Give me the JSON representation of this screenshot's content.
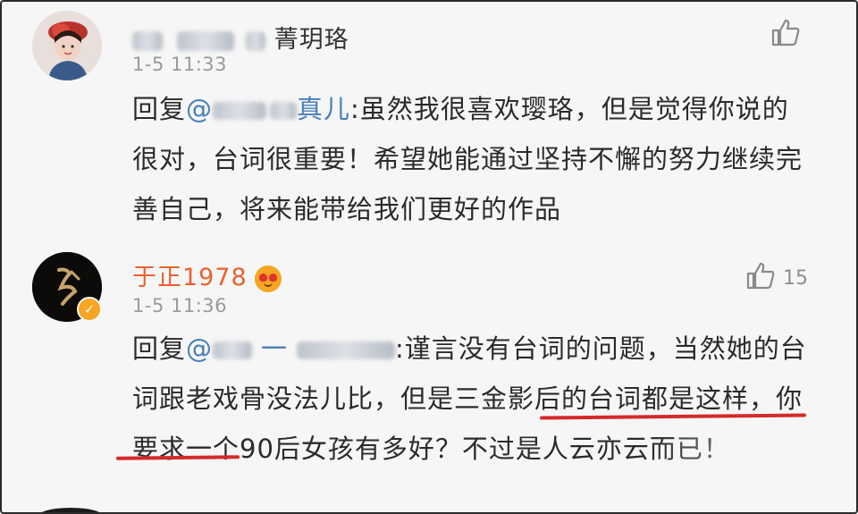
{
  "comments": [
    {
      "username_visible": "菁玥珞",
      "timestamp": "1-5 11:33",
      "like_count": "",
      "reply_prefix": "回复",
      "mention_visible": "真儿",
      "reply_text": ":虽然我很喜欢璎珞，但是觉得你说的很对，台词很重要！希望她能通过坚持不懈的努力继续完善自己，将来能带给我们更好的作品"
    },
    {
      "username": "于正1978",
      "timestamp": "1-5 11:36",
      "like_count": "15",
      "verified": true,
      "reply_prefix": "回复",
      "mention_visible": "@",
      "mention_tail": "一",
      "reply_text": ":谨言没有台词的问题，当然她的台词跟老戏骨没法儿比，但是三金影后的台词都是这样，你要求一个90后女孩有多好？不过是人云亦云而已！"
    }
  ],
  "icons": [
    "avatar",
    "thumbs-up-icon",
    "verified-badge-icon",
    "emoji-icon"
  ],
  "colors": {
    "username_accent": "#e8622e",
    "mention": "#4a7fb8",
    "underline": "#d42a2a",
    "meta": "#9a9a9a"
  }
}
